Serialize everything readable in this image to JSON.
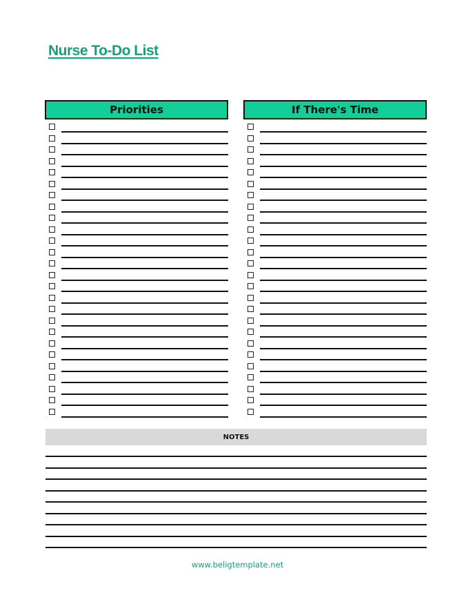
{
  "document": {
    "title": "Nurse To-Do List",
    "accent_color": "#12cf9a",
    "title_color": "#14a07a"
  },
  "columns": [
    {
      "heading": "Priorities",
      "row_count": 26
    },
    {
      "heading": "If There's Time",
      "row_count": 26
    }
  ],
  "notes": {
    "heading": "NOTES",
    "line_count": 9
  },
  "footer": {
    "url_text": "www.beligtemplate.net"
  }
}
